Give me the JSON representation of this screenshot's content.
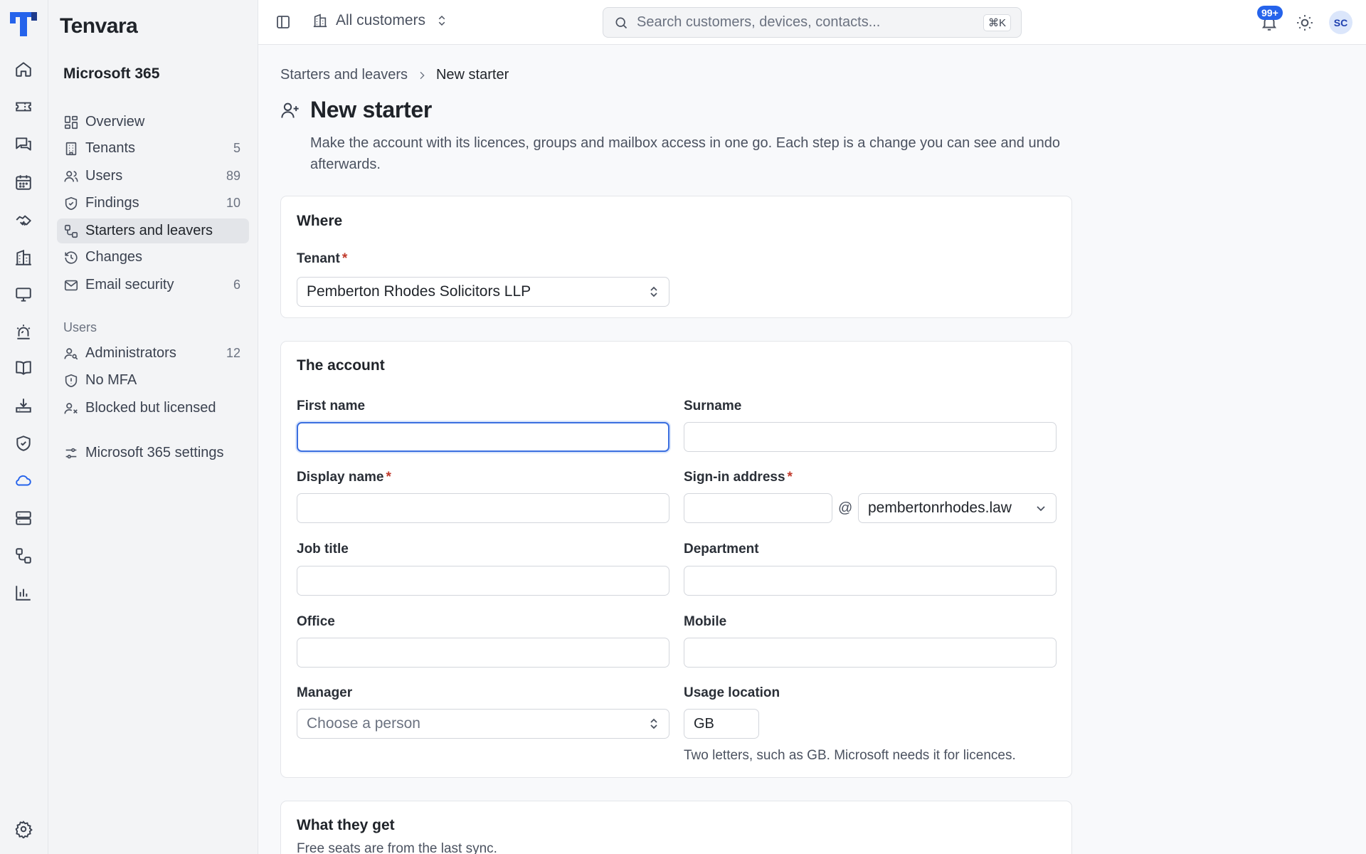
{
  "rail": {
    "items": [
      {
        "name": "home-icon"
      },
      {
        "name": "ticket-icon"
      },
      {
        "name": "messages-icon"
      },
      {
        "name": "calendar-icon"
      },
      {
        "name": "handshake-icon"
      },
      {
        "name": "building-icon"
      },
      {
        "name": "monitor-icon"
      },
      {
        "name": "alarm-icon"
      },
      {
        "name": "book-icon"
      },
      {
        "name": "download-tray-icon"
      },
      {
        "name": "shield-check-icon"
      },
      {
        "name": "cloud-icon"
      },
      {
        "name": "server-icon"
      },
      {
        "name": "workflow-icon"
      },
      {
        "name": "bar-chart-icon"
      }
    ],
    "active": "cloud-icon",
    "settings": "gear-icon"
  },
  "nav": {
    "brand": "Tenvara",
    "section_title": "Microsoft 365",
    "items": [
      {
        "label": "Overview",
        "count": "",
        "icon": "dashboard-icon"
      },
      {
        "label": "Tenants",
        "count": "5",
        "icon": "building-icon"
      },
      {
        "label": "Users",
        "count": "89",
        "icon": "users-icon"
      },
      {
        "label": "Findings",
        "count": "10",
        "icon": "shield-icon"
      },
      {
        "label": "Starters and leavers",
        "count": "",
        "icon": "workflow-icon",
        "active": true
      },
      {
        "label": "Changes",
        "count": "",
        "icon": "history-icon"
      },
      {
        "label": "Email security",
        "count": "6",
        "icon": "mail-icon"
      }
    ],
    "group_label": "Users",
    "group_items": [
      {
        "label": "Administrators",
        "count": "12",
        "icon": "user-key-icon"
      },
      {
        "label": "No MFA",
        "count": "",
        "icon": "shield-icon"
      },
      {
        "label": "Blocked but licensed",
        "count": "",
        "icon": "user-x-icon"
      }
    ],
    "settings_label": "Microsoft 365 settings"
  },
  "topbar": {
    "customer_label": "All customers",
    "search_placeholder": "Search customers, devices, contacts...",
    "shortcut": "⌘K",
    "notifications_badge": "99+",
    "avatar_initials": "SC"
  },
  "breadcrumb": {
    "parent": "Starters and leavers",
    "current": "New starter"
  },
  "page": {
    "title": "New starter",
    "description": "Make the account with its licences, groups and mailbox access in one go. Each step is a change you can see and undo afterwards."
  },
  "where": {
    "title": "Where",
    "tenant_label": "Tenant",
    "tenant_value": "Pemberton Rhodes Solicitors LLP"
  },
  "account": {
    "title": "The account",
    "first_name_label": "First name",
    "first_name_value": "",
    "surname_label": "Surname",
    "surname_value": "",
    "display_name_label": "Display name",
    "display_name_value": "",
    "signin_label": "Sign-in address",
    "signin_value": "",
    "at_sign": "@",
    "domain_value": "pembertonrhodes.law",
    "job_title_label": "Job title",
    "job_title_value": "",
    "department_label": "Department",
    "department_value": "",
    "office_label": "Office",
    "office_value": "",
    "mobile_label": "Mobile",
    "mobile_value": "",
    "manager_label": "Manager",
    "manager_placeholder": "Choose a person",
    "usage_location_label": "Usage location",
    "usage_location_value": "GB",
    "usage_location_hint": "Two letters, such as GB. Microsoft needs it for licences."
  },
  "what_they_get": {
    "title": "What they get",
    "subtitle": "Free seats are from the last sync."
  },
  "colors": {
    "accent": "#2563eb",
    "required": "#c0392b",
    "background": "#f8f9fb"
  }
}
